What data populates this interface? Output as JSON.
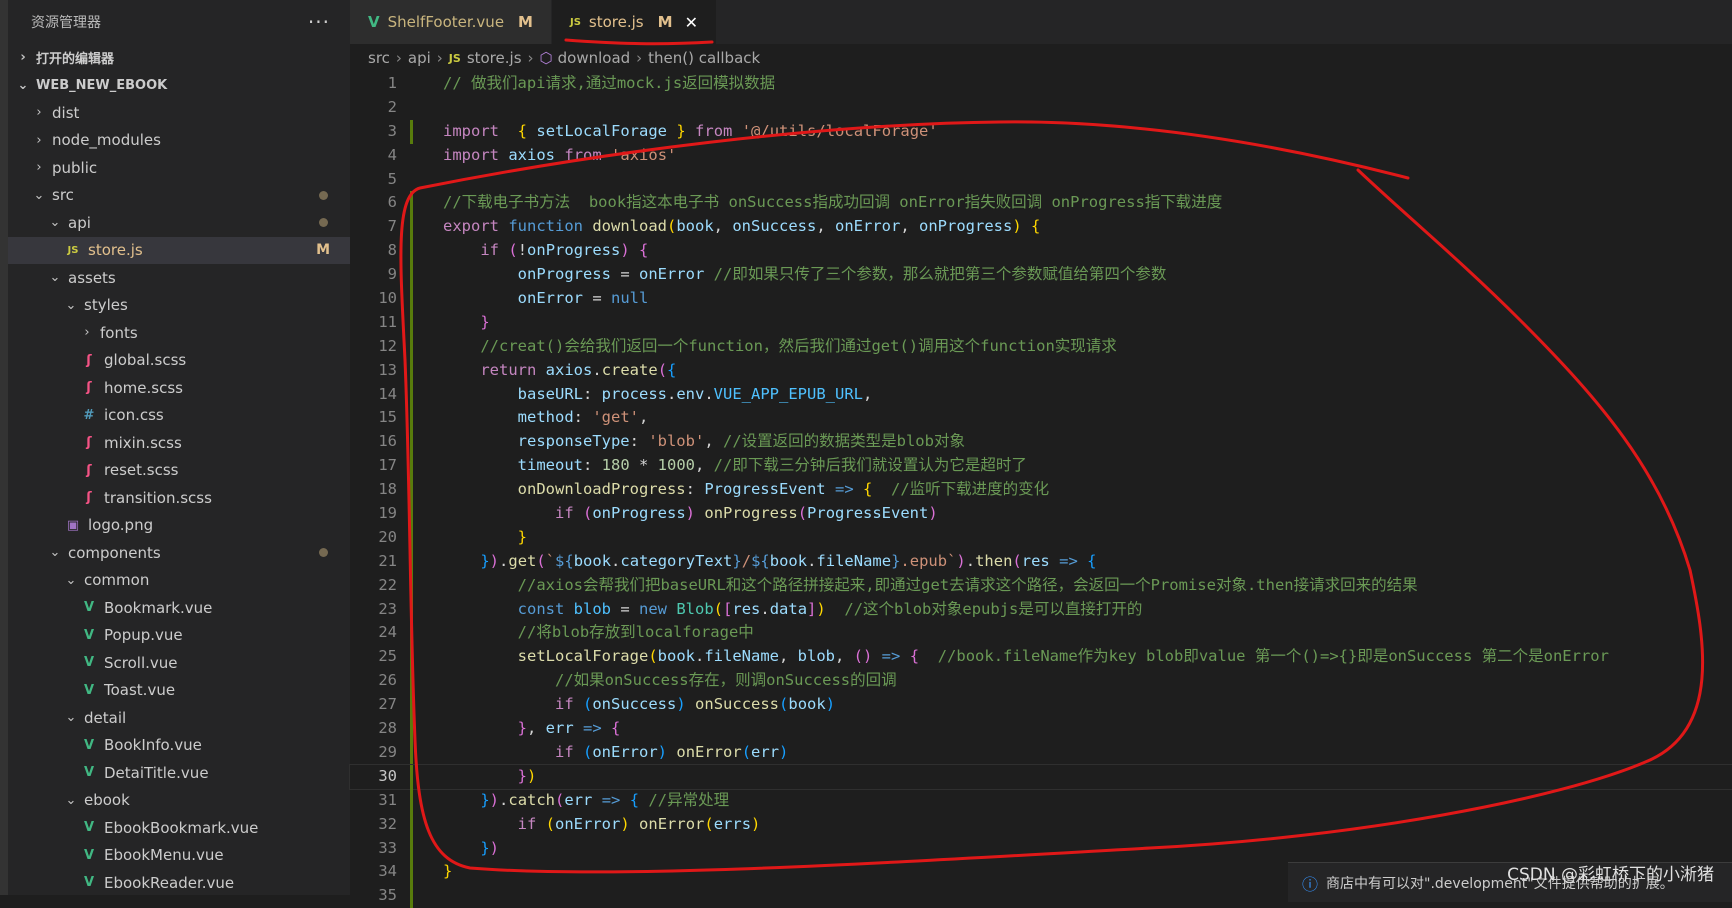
{
  "sidebar": {
    "title": "资源管理器",
    "more_label": "···",
    "items": [
      {
        "label": "打开的编辑器",
        "chev": "›",
        "section": true
      },
      {
        "label": "WEB_NEW_EBOOK",
        "chev": "⌄",
        "section": true
      },
      {
        "label": "dist",
        "chev": "›"
      },
      {
        "label": "node_modules",
        "chev": "›"
      },
      {
        "label": "public",
        "chev": "›"
      },
      {
        "label": "src",
        "chev": "⌄",
        "dot": true
      },
      {
        "label": "api",
        "chev": "⌄",
        "dot": true
      },
      {
        "label": "store.js",
        "icon": "JS",
        "badge": "M",
        "active": true
      },
      {
        "label": "assets",
        "chev": "⌄"
      },
      {
        "label": "styles",
        "chev": "⌄"
      },
      {
        "label": "fonts",
        "chev": "›"
      },
      {
        "label": "global.scss",
        "icon": "ʃ"
      },
      {
        "label": "home.scss",
        "icon": "ʃ"
      },
      {
        "label": "icon.css",
        "icon": "#"
      },
      {
        "label": "mixin.scss",
        "icon": "ʃ"
      },
      {
        "label": "reset.scss",
        "icon": "ʃ"
      },
      {
        "label": "transition.scss",
        "icon": "ʃ"
      },
      {
        "label": "logo.png",
        "icon": "▣"
      },
      {
        "label": "components",
        "chev": "⌄",
        "dot": true
      },
      {
        "label": "common",
        "chev": "⌄"
      },
      {
        "label": "Bookmark.vue",
        "icon": "V"
      },
      {
        "label": "Popup.vue",
        "icon": "V"
      },
      {
        "label": "Scroll.vue",
        "icon": "V"
      },
      {
        "label": "Toast.vue",
        "icon": "V"
      },
      {
        "label": "detail",
        "chev": "⌄"
      },
      {
        "label": "BookInfo.vue",
        "icon": "V"
      },
      {
        "label": "DetaiTitle.vue",
        "icon": "V"
      },
      {
        "label": "ebook",
        "chev": "⌄"
      },
      {
        "label": "EbookBookmark.vue",
        "icon": "V"
      },
      {
        "label": "EbookMenu.vue",
        "icon": "V"
      },
      {
        "label": "EbookReader.vue",
        "icon": "V"
      }
    ]
  },
  "tabs": [
    {
      "label": "ShelfFooter.vue",
      "icon": "V",
      "badge": "M",
      "active": false
    },
    {
      "label": "store.js",
      "icon": "JS",
      "badge": "M",
      "close": "✕",
      "active": true
    }
  ],
  "breadcrumb": {
    "parts": [
      "src",
      "api",
      "store.js",
      "download",
      "then() callback"
    ]
  },
  "editor": {
    "current_line": 30,
    "lines": [
      [
        [
          "c",
          "// 做我们api请求,通过mock.js返回模拟数据"
        ]
      ],
      [],
      [
        [
          "kc",
          "import"
        ],
        [
          "",
          "  "
        ],
        [
          "b1",
          "{"
        ],
        [
          "",
          " "
        ],
        [
          "v",
          "setLocalForage"
        ],
        [
          "",
          " "
        ],
        [
          "b1",
          "}"
        ],
        [
          "",
          " "
        ],
        [
          "kc",
          "from"
        ],
        [
          "",
          " "
        ],
        [
          "s",
          "'@/utils/localForage'"
        ]
      ],
      [
        [
          "kc",
          "import"
        ],
        [
          "",
          " "
        ],
        [
          "v",
          "axios"
        ],
        [
          "",
          " "
        ],
        [
          "kc",
          "from"
        ],
        [
          "",
          " "
        ],
        [
          "s",
          "'axios'"
        ]
      ],
      [],
      [
        [
          "c",
          "//下载电子书方法  book指这本电子书 onSuccess指成功回调 onError指失败回调 onProgress指下载进度"
        ]
      ],
      [
        [
          "kc",
          "export"
        ],
        [
          "",
          " "
        ],
        [
          "k",
          "function"
        ],
        [
          "",
          " "
        ],
        [
          "f",
          "download"
        ],
        [
          "b1",
          "("
        ],
        [
          "v",
          "book"
        ],
        [
          "",
          ", "
        ],
        [
          "v",
          "onSuccess"
        ],
        [
          "",
          ", "
        ],
        [
          "v",
          "onError"
        ],
        [
          "",
          ", "
        ],
        [
          "v",
          "onProgress"
        ],
        [
          "b1",
          ")"
        ],
        [
          "",
          " "
        ],
        [
          "b1",
          "{"
        ]
      ],
      [
        [
          "",
          "    "
        ],
        [
          "kc",
          "if"
        ],
        [
          "",
          " "
        ],
        [
          "b2",
          "("
        ],
        [
          "",
          "!"
        ],
        [
          "v",
          "onProgress"
        ],
        [
          "b2",
          ")"
        ],
        [
          "",
          " "
        ],
        [
          "b2",
          "{"
        ]
      ],
      [
        [
          "",
          "        "
        ],
        [
          "v",
          "onProgress"
        ],
        [
          "",
          " = "
        ],
        [
          "v",
          "onError"
        ],
        [
          "",
          " "
        ],
        [
          "c",
          "//即如果只传了三个参数，那么就把第三个参数赋值给第四个参数"
        ]
      ],
      [
        [
          "",
          "        "
        ],
        [
          "v",
          "onError"
        ],
        [
          "",
          " = "
        ],
        [
          "k",
          "null"
        ]
      ],
      [
        [
          "",
          "    "
        ],
        [
          "b2",
          "}"
        ]
      ],
      [
        [
          "",
          "    "
        ],
        [
          "c",
          "//creat()会给我们返回一个function，然后我们通过get()调用这个function实现请求"
        ]
      ],
      [
        [
          "",
          "    "
        ],
        [
          "kc",
          "return"
        ],
        [
          "",
          " "
        ],
        [
          "v",
          "axios"
        ],
        [
          "",
          "."
        ],
        [
          "f",
          "create"
        ],
        [
          "b2",
          "("
        ],
        [
          "b3",
          "{"
        ]
      ],
      [
        [
          "",
          "        "
        ],
        [
          "v",
          "baseURL"
        ],
        [
          "",
          ": "
        ],
        [
          "v",
          "process"
        ],
        [
          "",
          "."
        ],
        [
          "v",
          "env"
        ],
        [
          "",
          "."
        ],
        [
          "cn",
          "VUE_APP_EPUB_URL"
        ],
        [
          "",
          ","
        ]
      ],
      [
        [
          "",
          "        "
        ],
        [
          "v",
          "method"
        ],
        [
          "",
          ": "
        ],
        [
          "s",
          "'get'"
        ],
        [
          "",
          ","
        ]
      ],
      [
        [
          "",
          "        "
        ],
        [
          "v",
          "responseType"
        ],
        [
          "",
          ": "
        ],
        [
          "s",
          "'blob'"
        ],
        [
          "",
          ", "
        ],
        [
          "c",
          "//设置返回的数据类型是blob对象"
        ]
      ],
      [
        [
          "",
          "        "
        ],
        [
          "v",
          "timeout"
        ],
        [
          "",
          ": "
        ],
        [
          "n",
          "180"
        ],
        [
          "",
          " * "
        ],
        [
          "n",
          "1000"
        ],
        [
          "",
          ", "
        ],
        [
          "c",
          "//即下载三分钟后我们就设置认为它是超时了"
        ]
      ],
      [
        [
          "",
          "        "
        ],
        [
          "f",
          "onDownloadProgress"
        ],
        [
          "",
          ": "
        ],
        [
          "v",
          "ProgressEvent"
        ],
        [
          "",
          " "
        ],
        [
          "k",
          "=>"
        ],
        [
          "",
          " "
        ],
        [
          "b1",
          "{"
        ],
        [
          "",
          "  "
        ],
        [
          "c",
          "//监听下载进度的变化"
        ]
      ],
      [
        [
          "",
          "            "
        ],
        [
          "kc",
          "if"
        ],
        [
          "",
          " "
        ],
        [
          "b2",
          "("
        ],
        [
          "v",
          "onProgress"
        ],
        [
          "b2",
          ")"
        ],
        [
          "",
          " "
        ],
        [
          "f",
          "onProgress"
        ],
        [
          "b2",
          "("
        ],
        [
          "v",
          "ProgressEvent"
        ],
        [
          "b2",
          ")"
        ]
      ],
      [
        [
          "",
          "        "
        ],
        [
          "b1",
          "}"
        ]
      ],
      [
        [
          "",
          "    "
        ],
        [
          "b3",
          "}"
        ],
        [
          "b2",
          ")"
        ],
        [
          "",
          "."
        ],
        [
          "f",
          "get"
        ],
        [
          "b2",
          "("
        ],
        [
          "s",
          "`"
        ],
        [
          "k",
          "${"
        ],
        [
          "v",
          "book"
        ],
        [
          "",
          "."
        ],
        [
          "v",
          "categoryText"
        ],
        [
          "k",
          "}"
        ],
        [
          "s",
          "/"
        ],
        [
          "k",
          "${"
        ],
        [
          "v",
          "book"
        ],
        [
          "",
          "."
        ],
        [
          "v",
          "fileName"
        ],
        [
          "k",
          "}"
        ],
        [
          "s",
          ".epub`"
        ],
        [
          "b2",
          ")"
        ],
        [
          "",
          "."
        ],
        [
          "f",
          "then"
        ],
        [
          "b2",
          "("
        ],
        [
          "v",
          "res"
        ],
        [
          "",
          " "
        ],
        [
          "k",
          "=>"
        ],
        [
          "",
          " "
        ],
        [
          "b3",
          "{"
        ]
      ],
      [
        [
          "",
          "        "
        ],
        [
          "c",
          "//axios会帮我们把baseURL和这个路径拼接起来,即通过get去请求这个路径，会返回一个Promise对象.then接请求回来的结果"
        ]
      ],
      [
        [
          "",
          "        "
        ],
        [
          "k",
          "const"
        ],
        [
          "",
          " "
        ],
        [
          "cn",
          "blob"
        ],
        [
          "",
          " = "
        ],
        [
          "k",
          "new"
        ],
        [
          "",
          " "
        ],
        [
          "t",
          "Blob"
        ],
        [
          "b1",
          "("
        ],
        [
          "b2",
          "["
        ],
        [
          "v",
          "res"
        ],
        [
          "",
          "."
        ],
        [
          "v",
          "data"
        ],
        [
          "b2",
          "]"
        ],
        [
          "b1",
          ")"
        ],
        [
          "",
          "  "
        ],
        [
          "c",
          "//这个blob对象epubjs是可以直接打开的"
        ]
      ],
      [
        [
          "",
          "        "
        ],
        [
          "c",
          "//将blob存放到localforage中"
        ]
      ],
      [
        [
          "",
          "        "
        ],
        [
          "f",
          "setLocalForage"
        ],
        [
          "b1",
          "("
        ],
        [
          "v",
          "book"
        ],
        [
          "",
          "."
        ],
        [
          "v",
          "fileName"
        ],
        [
          "",
          ", "
        ],
        [
          "v",
          "blob"
        ],
        [
          "",
          ", "
        ],
        [
          "b2",
          "()"
        ],
        [
          "",
          " "
        ],
        [
          "k",
          "=>"
        ],
        [
          "",
          " "
        ],
        [
          "b2",
          "{"
        ],
        [
          "",
          "  "
        ],
        [
          "c",
          "//book.fileName作为key blob即value 第一个()=>{}即是onSuccess 第二个是onError"
        ]
      ],
      [
        [
          "",
          "            "
        ],
        [
          "c",
          "//如果onSuccess存在，则调onSuccess的回调"
        ]
      ],
      [
        [
          "",
          "            "
        ],
        [
          "kc",
          "if"
        ],
        [
          "",
          " "
        ],
        [
          "b3",
          "("
        ],
        [
          "v",
          "onSuccess"
        ],
        [
          "b3",
          ")"
        ],
        [
          "",
          " "
        ],
        [
          "f",
          "onSuccess"
        ],
        [
          "b3",
          "("
        ],
        [
          "v",
          "book"
        ],
        [
          "b3",
          ")"
        ]
      ],
      [
        [
          "",
          "        "
        ],
        [
          "b2",
          "}"
        ],
        [
          "",
          ", "
        ],
        [
          "v",
          "err"
        ],
        [
          "",
          " "
        ],
        [
          "k",
          "=>"
        ],
        [
          "",
          " "
        ],
        [
          "b2",
          "{"
        ]
      ],
      [
        [
          "",
          "            "
        ],
        [
          "kc",
          "if"
        ],
        [
          "",
          " "
        ],
        [
          "b3",
          "("
        ],
        [
          "v",
          "onError"
        ],
        [
          "b3",
          ")"
        ],
        [
          "",
          " "
        ],
        [
          "f",
          "onError"
        ],
        [
          "b3",
          "("
        ],
        [
          "v",
          "err"
        ],
        [
          "b3",
          ")"
        ]
      ],
      [
        [
          "",
          "        "
        ],
        [
          "b2",
          "}"
        ],
        [
          "b1",
          ")"
        ]
      ],
      [
        [
          "",
          "    "
        ],
        [
          "b3",
          "}"
        ],
        [
          "b2",
          ")"
        ],
        [
          "",
          "."
        ],
        [
          "f",
          "catch"
        ],
        [
          "b2",
          "("
        ],
        [
          "v",
          "err"
        ],
        [
          "",
          " "
        ],
        [
          "k",
          "=>"
        ],
        [
          "",
          " "
        ],
        [
          "b3",
          "{"
        ],
        [
          "",
          " "
        ],
        [
          "c",
          "//异常处理"
        ]
      ],
      [
        [
          "",
          "        "
        ],
        [
          "kc",
          "if"
        ],
        [
          "",
          " "
        ],
        [
          "b1",
          "("
        ],
        [
          "v",
          "onError"
        ],
        [
          "b1",
          ")"
        ],
        [
          "",
          " "
        ],
        [
          "f",
          "onError"
        ],
        [
          "b1",
          "("
        ],
        [
          "v",
          "errs"
        ],
        [
          "b1",
          ")"
        ]
      ],
      [
        [
          "",
          "    "
        ],
        [
          "b3",
          "}"
        ],
        [
          "b2",
          ")"
        ]
      ],
      [
        [
          "b1",
          "}"
        ]
      ],
      []
    ]
  },
  "notification": {
    "icon": "info-icon",
    "text": "商店中有可以对\".development\"文件提供帮助的扩展。"
  },
  "watermark": "CSDN @彩虹桥下的小淅猪",
  "colors": {
    "annotation_ink": "#e01818",
    "modified_badge": "#e2c08d",
    "vue_icon": "#41b883",
    "js_icon": "#cbcb41"
  }
}
